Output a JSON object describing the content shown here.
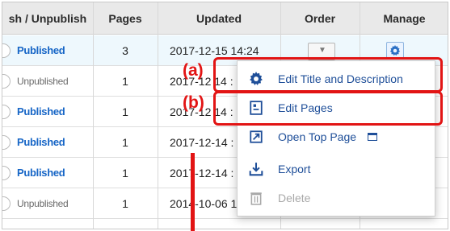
{
  "table": {
    "headers": {
      "status": "sh / Unpublish",
      "pages": "Pages",
      "updated": "Updated",
      "order": "Order",
      "manage": "Manage"
    },
    "rows": [
      {
        "status": "Published",
        "pages": "3",
        "updated": "2017-12-15 14:24"
      },
      {
        "status": "Unpublished",
        "pages": "1",
        "updated": "2017-12 14 :"
      },
      {
        "status": "Published",
        "pages": "1",
        "updated": "2017-12 14 :"
      },
      {
        "status": "Published",
        "pages": "1",
        "updated": "2017-12-14 :"
      },
      {
        "status": "Published",
        "pages": "1",
        "updated": "2017-12-14 :"
      },
      {
        "status": "Unpublished",
        "pages": "1",
        "updated": "2014-10-06 1"
      }
    ]
  },
  "menu": {
    "items": [
      {
        "label": "Edit Title and Description",
        "icon": "gear-icon"
      },
      {
        "label": "Edit Pages",
        "icon": "page-icon"
      },
      {
        "label": "Open Top Page",
        "icon": "open-page-icon"
      },
      {
        "label": "Export",
        "icon": "export-icon"
      },
      {
        "label": "Delete",
        "icon": "trash-icon"
      }
    ]
  },
  "annotations": {
    "a": "(a)",
    "b": "(b)"
  },
  "colors": {
    "link_blue": "#1665c6",
    "menu_text": "#1f4f99",
    "annotation_red": "#e21414",
    "highlight_row": "#eef8fd"
  }
}
